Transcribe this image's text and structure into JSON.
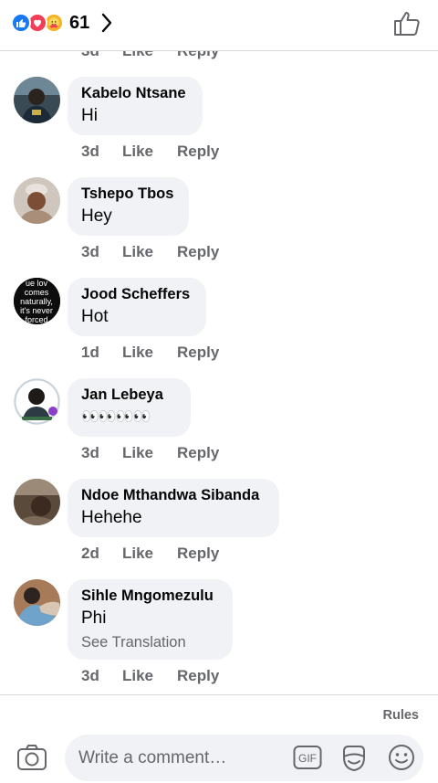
{
  "header": {
    "reaction_count": "61",
    "reaction_icons": [
      "like-reaction-icon",
      "love-reaction-icon",
      "care-reaction-icon"
    ]
  },
  "partial_row": {
    "time": "3d",
    "like": "Like",
    "reply": "Reply"
  },
  "comments": [
    {
      "author": "Kabelo Ntsane",
      "text": "Hi",
      "time": "3d",
      "like": "Like",
      "reply": "Reply"
    },
    {
      "author": "Tshepo Tbos",
      "text": "Hey",
      "time": "3d",
      "like": "Like",
      "reply": "Reply"
    },
    {
      "author": "Jood Scheffers",
      "text": "Hot",
      "time": "1d",
      "like": "Like",
      "reply": "Reply",
      "avatar_text": [
        "ue lov",
        "comes",
        "naturally,",
        "it's never",
        "forced"
      ]
    },
    {
      "author": "Jan Lebeya",
      "text": "👀👀👀👀",
      "time": "3d",
      "like": "Like",
      "reply": "Reply"
    },
    {
      "author": "Ndoe Mthandwa Sibanda",
      "text": "Hehehe",
      "time": "2d",
      "like": "Like",
      "reply": "Reply"
    },
    {
      "author": "Sihle Mngomezulu",
      "text": "Phi",
      "see_translation": "See Translation",
      "time": "3d",
      "like": "Like",
      "reply": "Reply"
    }
  ],
  "composer": {
    "rules": "Rules",
    "placeholder": "Write a comment…",
    "gif_label": "GIF"
  },
  "colors": {
    "like_blue": "#1877f2",
    "love_red": "#f33e58",
    "care_yellow": "#f7b125",
    "bubble_bg": "#f0f2f5",
    "meta_gray": "#65676b"
  }
}
